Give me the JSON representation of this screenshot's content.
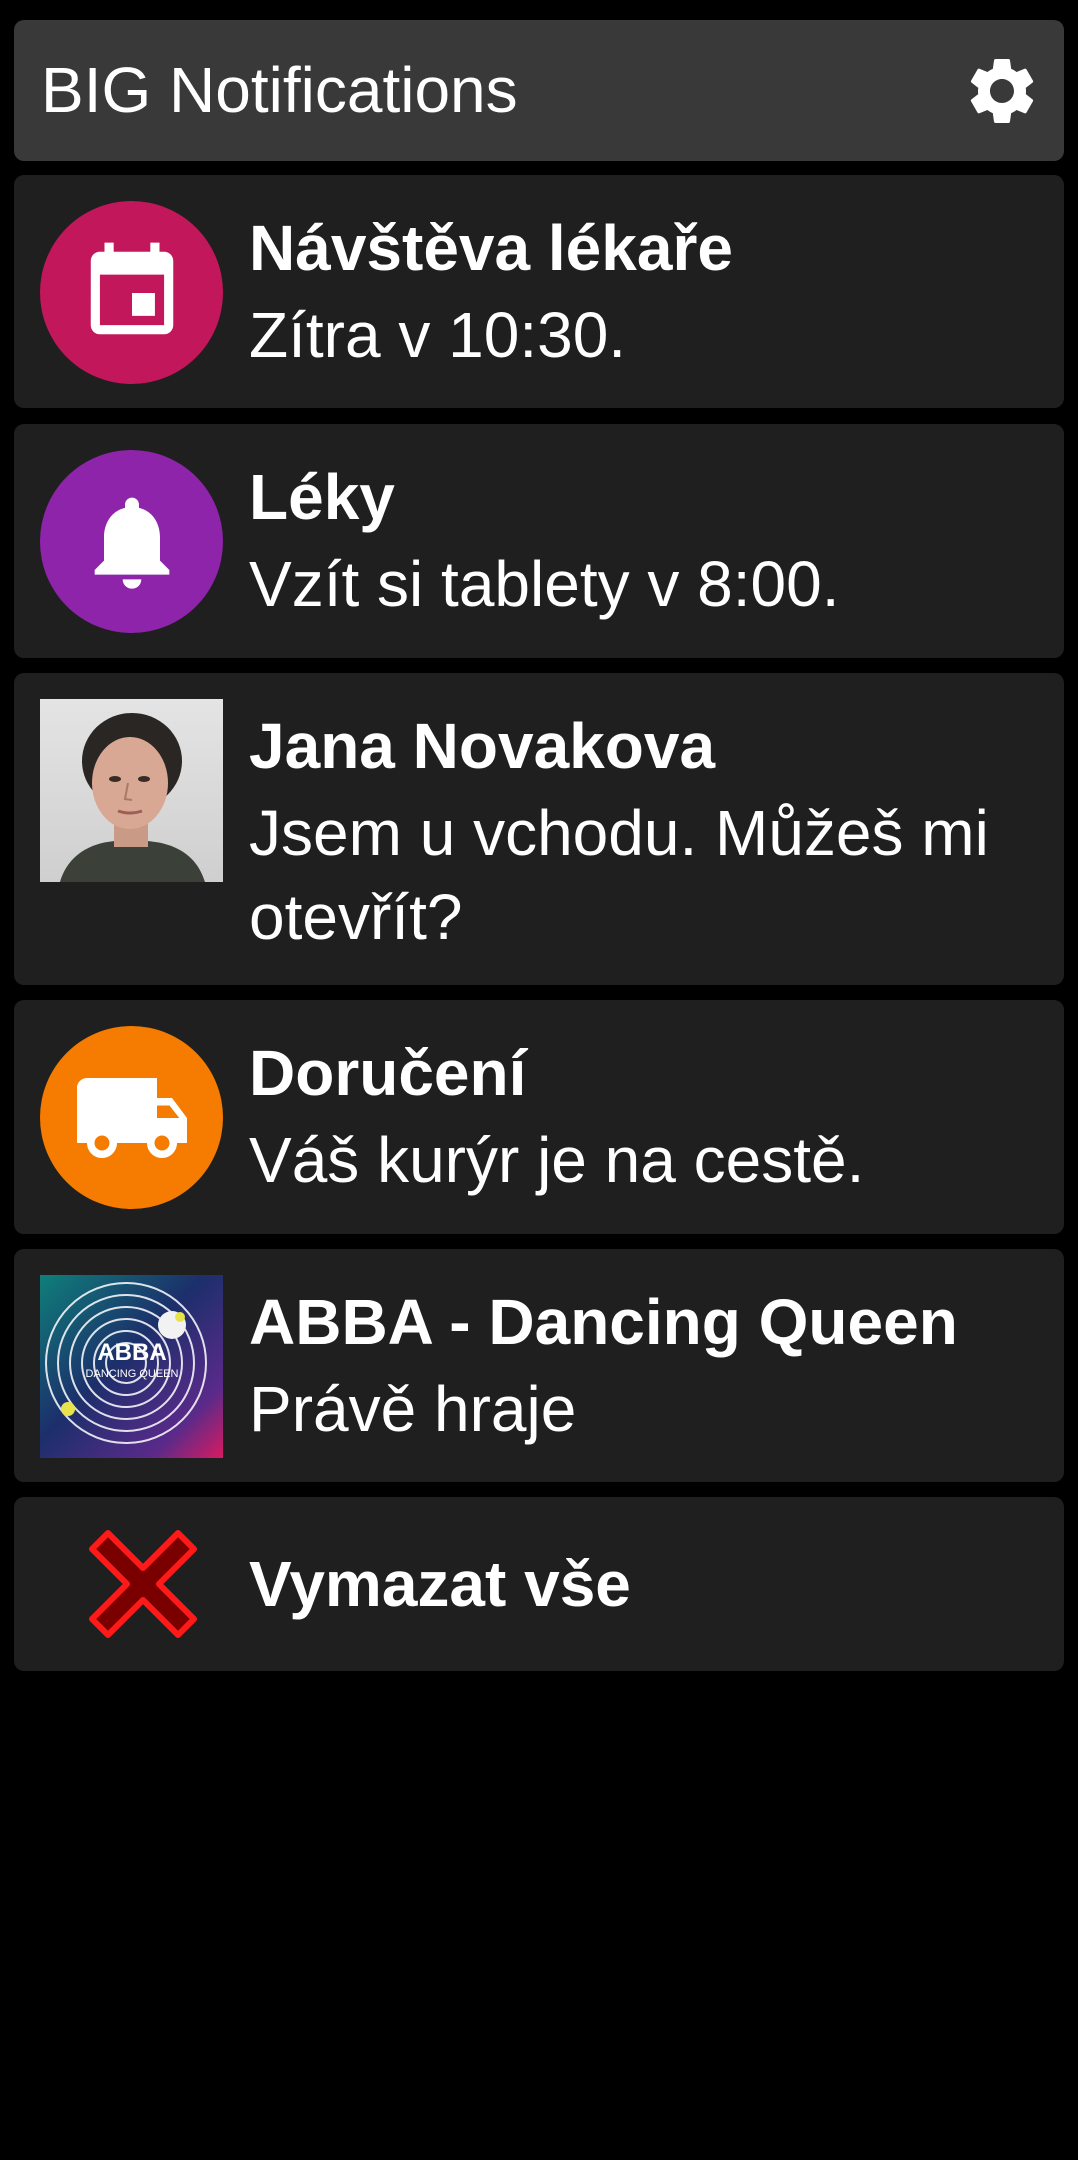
{
  "header": {
    "title": "BIG Notifications",
    "settings_icon": "gear-icon"
  },
  "notifications": [
    {
      "title": "Návštěva lékaře",
      "body": "Zítra v 10:30.",
      "icon": "calendar-icon",
      "color": "#c2185b"
    },
    {
      "title": "Léky",
      "body": "Vzít si tablety v 8:00.",
      "icon": "bell-icon",
      "color": "#8e24aa"
    },
    {
      "title": "Jana Novakova",
      "body": "Jsem u vchodu. Můžeš mi otevřít?",
      "icon": "contact-photo"
    },
    {
      "title": "Doručení",
      "body": "Váš kurýr je na cestě.",
      "icon": "truck-icon",
      "color": "#f57c00"
    },
    {
      "title": "ABBA - Dancing Queen",
      "body": "Právě hraje",
      "icon": "album-art",
      "album_text": "ABBA",
      "album_subtext": "DANCING QUEEN"
    }
  ],
  "clear_all": {
    "label": "Vymazat vše",
    "icon": "close-icon",
    "color": "#e00000"
  },
  "colors": {
    "background": "#000000",
    "header": "#393939",
    "card": "#1f1f1f"
  }
}
